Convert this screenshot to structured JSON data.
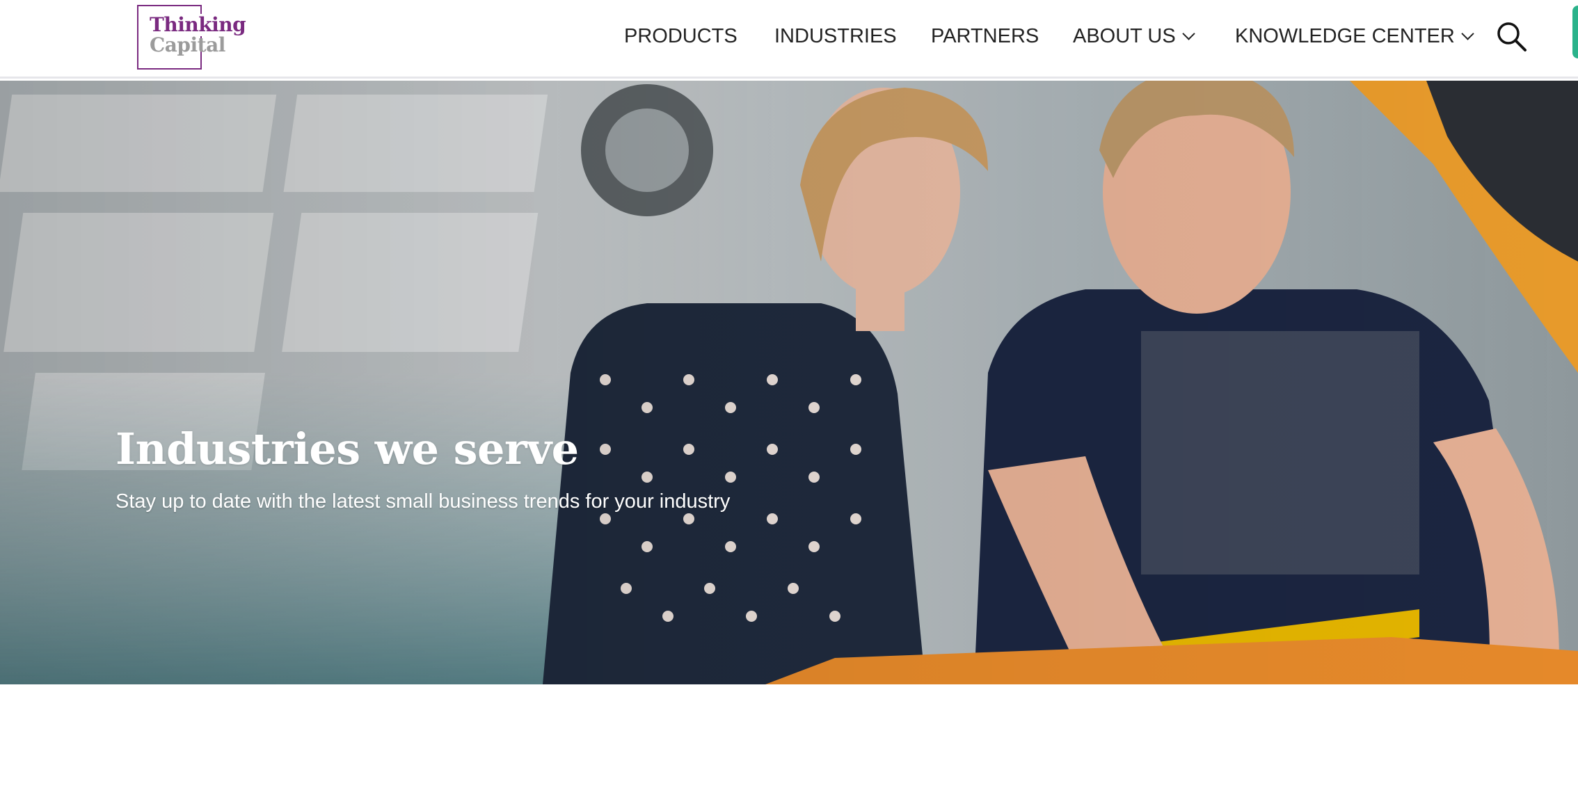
{
  "brand": {
    "logo_line1": "Thinking",
    "logo_line2": "Capital",
    "color_primary": "#7a2a80",
    "color_secondary": "#9b9b9b",
    "accent": "#2bb38b"
  },
  "nav": {
    "items": [
      {
        "label": "PRODUCTS",
        "has_dropdown": false
      },
      {
        "label": "INDUSTRIES",
        "has_dropdown": false
      },
      {
        "label": "PARTNERS",
        "has_dropdown": false
      },
      {
        "label": "ABOUT US",
        "has_dropdown": true
      },
      {
        "label": "KNOWLEDGE CENTER",
        "has_dropdown": true
      }
    ],
    "search_icon": "search-icon"
  },
  "hero": {
    "title": "Industries we serve",
    "subtitle": "Stay up to date with the latest small business trends for your industry",
    "image": "auto-mechanic-with-customer-photo"
  }
}
